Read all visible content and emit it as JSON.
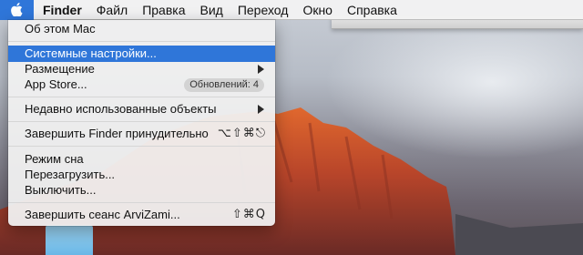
{
  "colors": {
    "accent": "#2f76d9",
    "menu_bg": "#f0f0f0",
    "menubar_bg": "#f3f3f3"
  },
  "menubar": {
    "apple_icon": "apple-logo-icon",
    "items": [
      {
        "label": "Finder"
      },
      {
        "label": "Файл"
      },
      {
        "label": "Правка"
      },
      {
        "label": "Вид"
      },
      {
        "label": "Переход"
      },
      {
        "label": "Окно"
      },
      {
        "label": "Справка"
      }
    ]
  },
  "apple_menu": {
    "about": "Об этом Mac",
    "system_prefs": "Системные настройки...",
    "location": "Размещение",
    "app_store": "App Store...",
    "updates_badge": "Обновлений: 4",
    "recent_items": "Недавно использованные объекты",
    "force_quit": "Завершить Finder принудительно",
    "force_quit_shortcut": "⌥⇧⌘⎋",
    "sleep": "Режим сна",
    "restart": "Перезагрузить...",
    "shutdown": "Выключить...",
    "logout": "Завершить сеанс ArviZami...",
    "logout_shortcut": "⇧⌘Q"
  }
}
